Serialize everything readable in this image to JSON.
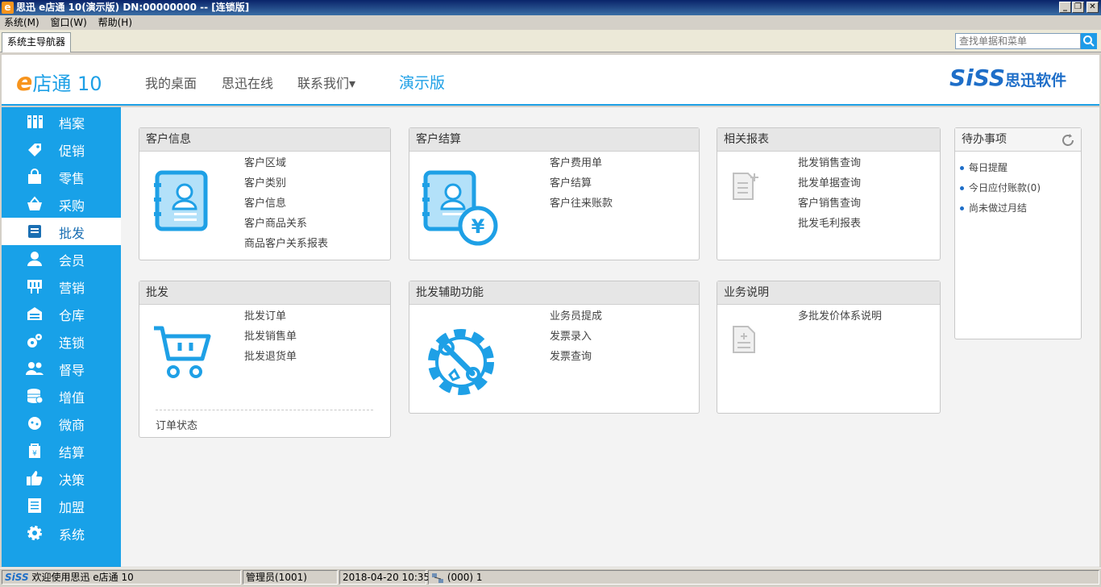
{
  "window": {
    "logo_letter": "e",
    "title": "思迅 e店通 10(演示版) DN:00000000 -- [连锁版]",
    "min": "_",
    "restore": "❐",
    "close": "✕"
  },
  "menu": [
    "系统(M)",
    "窗口(W)",
    "帮助(H)"
  ],
  "tab": {
    "label": "系统主导航器"
  },
  "search": {
    "placeholder": "查找单据和菜单"
  },
  "header": {
    "logo_e": "e",
    "logo_text": "店通",
    "logo_num": "10",
    "nav": [
      "我的桌面",
      "思迅在线",
      "联系我们▾"
    ],
    "edition": "演示版",
    "brand_en": "SiSS",
    "brand_cn": "思迅软件"
  },
  "sidebar": {
    "items": [
      {
        "label": "档案",
        "icon": "archive-icon"
      },
      {
        "label": "促销",
        "icon": "tag-icon"
      },
      {
        "label": "零售",
        "icon": "shopping-bag-icon"
      },
      {
        "label": "采购",
        "icon": "basket-icon"
      },
      {
        "label": "批发",
        "icon": "wholesale-icon",
        "active": true
      },
      {
        "label": "会员",
        "icon": "member-icon"
      },
      {
        "label": "营销",
        "icon": "billboard-icon"
      },
      {
        "label": "仓库",
        "icon": "warehouse-icon"
      },
      {
        "label": "连锁",
        "icon": "gears-icon"
      },
      {
        "label": "督导",
        "icon": "supervisor-icon"
      },
      {
        "label": "增值",
        "icon": "coins-icon"
      },
      {
        "label": "微商",
        "icon": "chat-icon"
      },
      {
        "label": "结算",
        "icon": "settlement-icon"
      },
      {
        "label": "决策",
        "icon": "thumbs-up-icon"
      },
      {
        "label": "加盟",
        "icon": "document-icon"
      },
      {
        "label": "系统",
        "icon": "settings-icon"
      }
    ]
  },
  "panels": {
    "customer_info": {
      "title": "客户信息",
      "icon": "contact-card-icon",
      "links": [
        "客户区域",
        "客户类别",
        "客户信息",
        "客户商品关系",
        "商品客户关系报表"
      ]
    },
    "customer_settle": {
      "title": "客户结算",
      "icon": "contact-card-yen-icon",
      "links": [
        "客户费用单",
        "客户结算",
        "客户往来账款"
      ]
    },
    "reports": {
      "title": "相关报表",
      "icon": "report-doc-icon",
      "links": [
        "批发销售查询",
        "批发单据查询",
        "客户销售查询",
        "批发毛利报表"
      ]
    },
    "wholesale": {
      "title": "批发",
      "icon": "cart-icon",
      "links": [
        "批发订单",
        "批发销售单",
        "批发退货单"
      ],
      "footer_link": "订单状态"
    },
    "aux": {
      "title": "批发辅助功能",
      "icon": "gear-wrench-icon",
      "links": [
        "业务员提成",
        "发票录入",
        "发票查询"
      ]
    },
    "biz_desc": {
      "title": "业务说明",
      "icon": "note-doc-icon",
      "links": [
        "多批发价体系说明"
      ]
    }
  },
  "todo": {
    "title": "待办事项",
    "refresh_icon": "refresh-icon",
    "items": [
      "每日提醒",
      "今日应付账款(0)",
      "尚未做过月结"
    ]
  },
  "status": {
    "brand": "SiSS",
    "welcome": "欢迎使用思迅 e店通 10",
    "user": "管理员(1001)",
    "datetime": "2018-04-20 10:35",
    "conn": "(000) 1"
  },
  "colors": {
    "accent": "#18a1e8",
    "brand": "#1e6ec8",
    "orange": "#f7941d"
  }
}
